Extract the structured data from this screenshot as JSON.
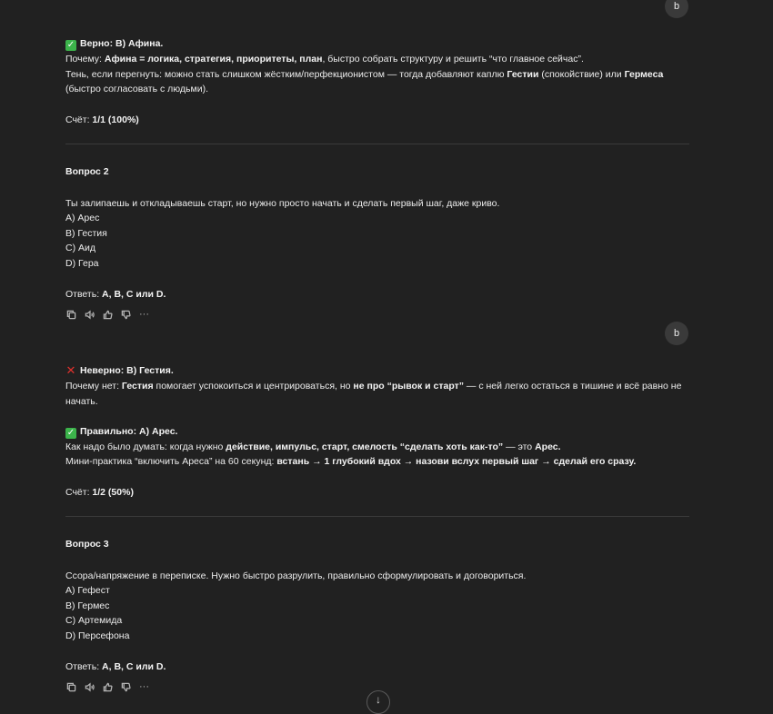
{
  "user_initial": "b",
  "answer1": {
    "verdict": "Верно: B) Афина.",
    "why_label": "Почему: ",
    "why_bold": "Афина = логика, стратегия, приоритеты, план",
    "why_rest": ", быстро собрать структуру и решить “что главное сейчас”.",
    "shadow_1": "Тень, если перегнуть: можно стать слишком жёстким/перфекционистом — тогда добавляют каплю ",
    "shadow_b1": "Гестии",
    "shadow_2": " (спокойствие) или ",
    "shadow_b2": "Гермеса",
    "shadow_3": "(быстро согласовать с людьми).",
    "score_label": "Счёт: ",
    "score_value": "1/1 (100%)"
  },
  "question2": {
    "title": "Вопрос 2",
    "text": "Ты залипаешь и откладываешь старт, но нужно просто начать и сделать первый шаг, даже криво.",
    "options": [
      "A) Арес",
      "B) Гестия",
      "C) Аид",
      "D) Гера"
    ],
    "answer_label": "Ответь: ",
    "answer_value": "A, B, C или D."
  },
  "answer2": {
    "verdict": "Неверно: B) Гестия.",
    "why_1": "Почему нет: ",
    "why_b1": "Гестия",
    "why_2": " помогает успокоиться и центрироваться, но ",
    "why_b2": "не про “рывок и старт”",
    "why_3": " — с ней легко остаться в тишине и всё равно не",
    "why_4": "начать.",
    "correct": "Правильно: A) Арес.",
    "think_1": "Как надо было думать: когда нужно ",
    "think_b1": "действие, импульс, старт, смелость “сделать хоть как-то”",
    "think_2": " — это ",
    "think_b2": "Арес.",
    "practice_1": "Мини-практика “включить Ареса” на 60 секунд: ",
    "practice_b": "встань → 1 глубокий вдох → назови вслух первый шаг → сделай его сразу.",
    "score_label": "Счёт: ",
    "score_value": "1/2 (50%)"
  },
  "question3": {
    "title": "Вопрос 3",
    "text": "Ссора/напряжение в переписке. Нужно быстро разрулить, правильно сформулировать и договориться.",
    "options": [
      "A) Гефест",
      "B) Гермес",
      "C) Артемида",
      "D) Персефона"
    ],
    "answer_label": "Ответь: ",
    "answer_value": "A, B, C или D."
  },
  "actions": [
    "copy-icon",
    "speaker-icon",
    "thumbs-up-icon",
    "thumbs-down-icon",
    "more-icon"
  ]
}
